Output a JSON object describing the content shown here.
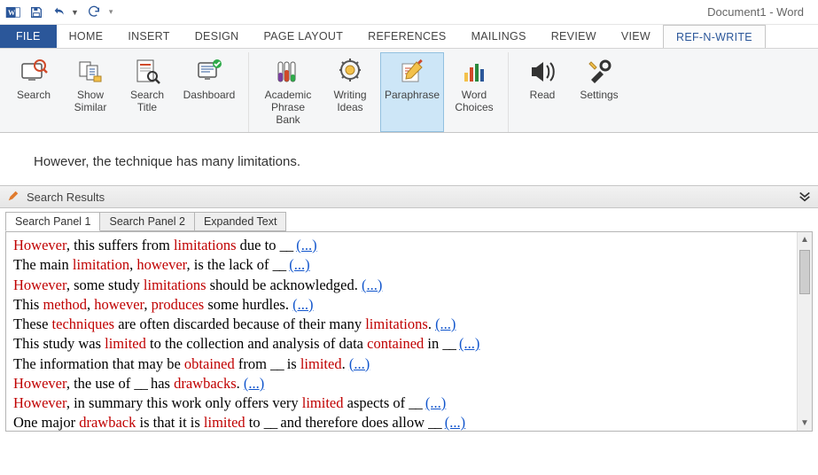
{
  "window": {
    "title": "Document1 - Word"
  },
  "ribbon_tabs": {
    "file": "FILE",
    "items": [
      "HOME",
      "INSERT",
      "DESIGN",
      "PAGE LAYOUT",
      "REFERENCES",
      "MAILINGS",
      "REVIEW",
      "VIEW"
    ],
    "addin": "REF-N-WRITE"
  },
  "ribbon": {
    "search": "Search",
    "show_similar": "Show\nSimilar",
    "search_title": "Search\nTitle",
    "dashboard": "Dashboard",
    "academic_phrase_bank": "Academic\nPhrase Bank",
    "writing_ideas": "Writing\nIdeas",
    "paraphrase": "Paraphrase",
    "word_choices": "Word\nChoices",
    "read": "Read",
    "settings": "Settings"
  },
  "sentence": "However, the technique has many limitations.",
  "sr_header": "Search Results",
  "panel_tabs": [
    "Search Panel 1",
    "Search Panel 2",
    "Expanded Text"
  ],
  "results": [
    {
      "segments": [
        {
          "t": "However",
          "kw": true
        },
        {
          "t": ", this suffers from "
        },
        {
          "t": "limitations",
          "kw": true
        },
        {
          "t": " due to "
        },
        {
          "t": "__",
          "blank": true
        },
        {
          "t": "  "
        }
      ],
      "more": "(...)"
    },
    {
      "segments": [
        {
          "t": "The main "
        },
        {
          "t": "limitation",
          "kw": true
        },
        {
          "t": ", "
        },
        {
          "t": "however",
          "kw": true
        },
        {
          "t": ", is the lack of "
        },
        {
          "t": "__",
          "blank": true
        },
        {
          "t": "  "
        }
      ],
      "more": "(...)"
    },
    {
      "segments": [
        {
          "t": "However",
          "kw": true
        },
        {
          "t": ", some study "
        },
        {
          "t": "limitations",
          "kw": true
        },
        {
          "t": " should be acknowledged.  "
        }
      ],
      "more": "(...)"
    },
    {
      "segments": [
        {
          "t": "This "
        },
        {
          "t": "method",
          "kw": true
        },
        {
          "t": ", "
        },
        {
          "t": "however",
          "kw": true
        },
        {
          "t": ", "
        },
        {
          "t": "produces",
          "kw": true
        },
        {
          "t": " some hurdles.  "
        }
      ],
      "more": "(...)"
    },
    {
      "segments": [
        {
          "t": "These "
        },
        {
          "t": "techniques",
          "kw": true
        },
        {
          "t": " are often discarded because of their many "
        },
        {
          "t": "limitations",
          "kw": true
        },
        {
          "t": ".  "
        }
      ],
      "more": "(...)"
    },
    {
      "segments": [
        {
          "t": "This study was "
        },
        {
          "t": "limited",
          "kw": true
        },
        {
          "t": " to the collection and analysis of data "
        },
        {
          "t": "contained",
          "kw": true
        },
        {
          "t": " in "
        },
        {
          "t": "__",
          "blank": true
        },
        {
          "t": "    "
        }
      ],
      "more": "(...)"
    },
    {
      "segments": [
        {
          "t": "The information that may be "
        },
        {
          "t": "obtained",
          "kw": true
        },
        {
          "t": " from "
        },
        {
          "t": "__",
          "blank": true
        },
        {
          "t": " is "
        },
        {
          "t": "limited",
          "kw": true
        },
        {
          "t": ".  "
        }
      ],
      "more": "(...)"
    },
    {
      "segments": [
        {
          "t": "However",
          "kw": true
        },
        {
          "t": ", the use of "
        },
        {
          "t": "__",
          "blank": true
        },
        {
          "t": " has "
        },
        {
          "t": "drawbacks",
          "kw": true
        },
        {
          "t": ".  "
        }
      ],
      "more": "(...)"
    },
    {
      "segments": [
        {
          "t": "However",
          "kw": true
        },
        {
          "t": ", in summary this work only offers very "
        },
        {
          "t": "limited",
          "kw": true
        },
        {
          "t": " aspects of "
        },
        {
          "t": "__",
          "blank": true
        },
        {
          "t": "  "
        }
      ],
      "more": "(...)"
    },
    {
      "segments": [
        {
          "t": "One major "
        },
        {
          "t": "drawback",
          "kw": true
        },
        {
          "t": " is that it is "
        },
        {
          "t": "limited",
          "kw": true
        },
        {
          "t": " to "
        },
        {
          "t": "__",
          "blank": true
        },
        {
          "t": " and therefore does allow "
        },
        {
          "t": "__",
          "blank": true
        },
        {
          "t": "   "
        }
      ],
      "more": "(...)"
    }
  ]
}
